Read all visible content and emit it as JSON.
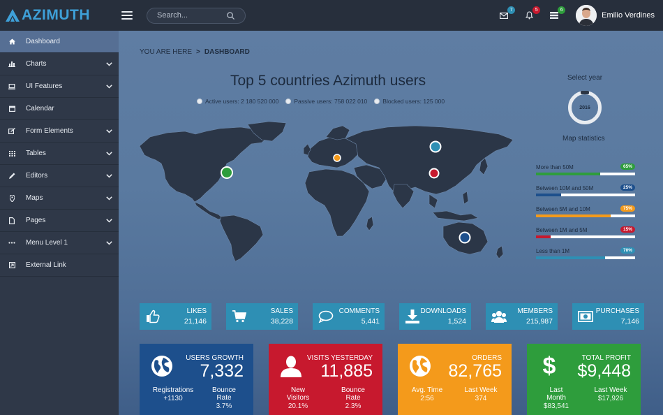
{
  "app": {
    "name": "AZIMUTH"
  },
  "header": {
    "search_placeholder": "Search...",
    "mail_count": "7",
    "bell_count": "5",
    "tasks_count": "6",
    "user_name": "Emilio Verdines"
  },
  "sidebar": {
    "items": [
      {
        "label": "Dashboard",
        "icon": "home-icon"
      },
      {
        "label": "Charts",
        "icon": "bar-chart-icon"
      },
      {
        "label": "UI Features",
        "icon": "laptop-icon"
      },
      {
        "label": "Calendar",
        "icon": "calendar-icon"
      },
      {
        "label": "Form Elements",
        "icon": "edit-icon"
      },
      {
        "label": "Tables",
        "icon": "grid-icon"
      },
      {
        "label": "Editors",
        "icon": "pencil-icon"
      },
      {
        "label": "Maps",
        "icon": "map-marker-icon"
      },
      {
        "label": "Pages",
        "icon": "page-icon"
      },
      {
        "label": "Menu Level 1",
        "icon": "ellipsis-icon"
      },
      {
        "label": "External Link",
        "icon": "external-link-icon"
      }
    ]
  },
  "breadcrumb": {
    "prefix": "YOU ARE HERE",
    "separator": ">",
    "current": "DASHBOARD"
  },
  "map": {
    "title": "Top 5 countries Azimuth users",
    "legend": {
      "active": "Active users: 2 180 520 000",
      "passive": "Passive users: 758 022 010",
      "blocked": "Blocked users: 125 000"
    }
  },
  "year": {
    "label": "Select year",
    "value": "2016"
  },
  "map_stats": {
    "title": "Map statistics",
    "rows": [
      {
        "label": "More than 50M",
        "badge": "65%",
        "percent": 65,
        "color": "#2e9d3c"
      },
      {
        "label": "Between 10M and 50M",
        "badge": "25%",
        "percent": 25,
        "color": "#1d4f8c"
      },
      {
        "label": "Between 5M and 10M",
        "badge": "75%",
        "percent": 75,
        "color": "#f49a1b"
      },
      {
        "label": "Between 1M and 5M",
        "badge": "15%",
        "percent": 15,
        "color": "#c7192e"
      },
      {
        "label": "Less than 1M",
        "badge": "70%",
        "percent": 70,
        "color": "#2e8fb4"
      }
    ]
  },
  "tiles": [
    {
      "label": "LIKES",
      "value": "21,146",
      "icon": "thumbs-up-icon"
    },
    {
      "label": "SALES",
      "value": "38,228",
      "icon": "cart-icon"
    },
    {
      "label": "COMMENTS",
      "value": "5,441",
      "icon": "comment-icon"
    },
    {
      "label": "DOWNLOADS",
      "value": "1,524",
      "icon": "download-icon"
    },
    {
      "label": "MEMBERS",
      "value": "215,987",
      "icon": "users-icon"
    },
    {
      "label": "PURCHASES",
      "value": "7,146",
      "icon": "money-icon"
    }
  ],
  "cards": [
    {
      "label": "USERS GROWTH",
      "value": "7,332",
      "color": "#1d4f8c",
      "icon": "globe-icon",
      "sub1_label": "Registrations",
      "sub1_value": "+1130",
      "sub2_label": "Bounce Rate",
      "sub2_value": "3.7%"
    },
    {
      "label": "VISITS YESTERDAY",
      "value": "11,885",
      "color": "#c7192e",
      "icon": "user-icon",
      "sub1_label": "New Visitors",
      "sub1_value": "20.1%",
      "sub2_label": "Bounce Rate",
      "sub2_value": "2.3%"
    },
    {
      "label": "ORDERS",
      "value": "82,765",
      "color": "#f49a1b",
      "icon": "globe-icon",
      "sub1_label": "Avg. Time",
      "sub1_value": "2:56",
      "sub2_label": "Last Week",
      "sub2_value": "374"
    },
    {
      "label": "TOTAL PROFIT",
      "value": "$9,448",
      "color": "#2e9d3c",
      "icon": "dollar-icon",
      "sub1_label": "Last Month",
      "sub1_value": "$83,541",
      "sub2_label": "Last Week",
      "sub2_value": "$17,926"
    }
  ],
  "colors": {
    "accent_blue": "#3ea0d8",
    "tile_blue": "#2e8fb4",
    "badge_mail": "#2e8fb4",
    "badge_bell": "#c7192e",
    "badge_tasks": "#2e9d3c",
    "marker_green": "#2e9d3c",
    "marker_orange": "#f49a1b",
    "marker_teal": "#2e8fb4",
    "marker_red": "#c7192e",
    "marker_blue": "#1d4f8c"
  }
}
